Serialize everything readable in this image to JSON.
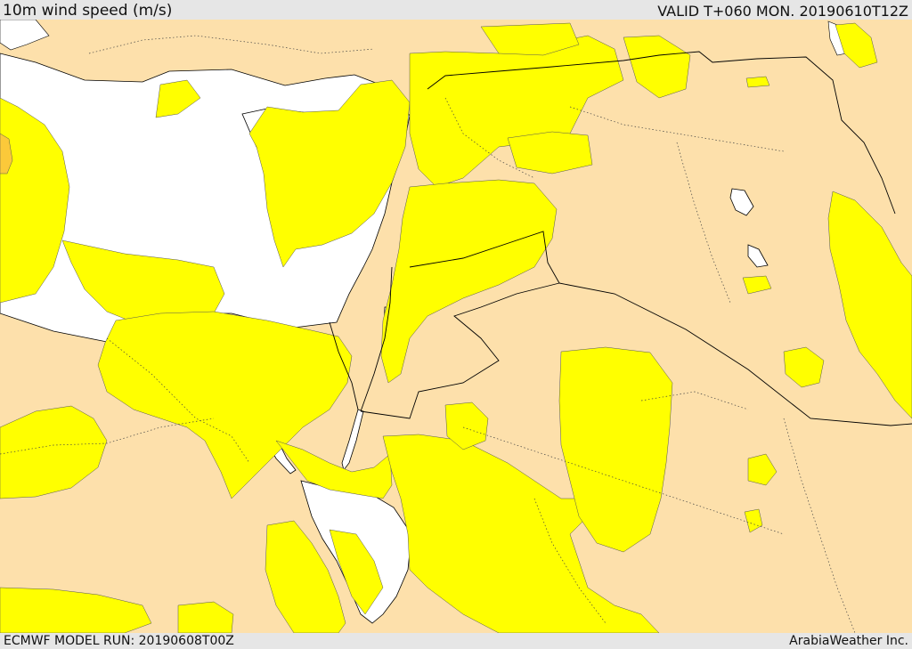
{
  "header": {
    "title": "10m wind speed (m/s)",
    "valid": "VALID T+060 MON. 20190610T12Z"
  },
  "footer": {
    "model_run": "ECMWF MODEL RUN: 20190608T00Z",
    "provider": "ArabiaWeather Inc."
  },
  "colors": {
    "land_low": "#fde0ab",
    "wind_band": "#ffff00",
    "wind_strong": "#fbc93a",
    "sea": "#ffffff",
    "border": "#000000",
    "bar": "#e6e6e6"
  }
}
